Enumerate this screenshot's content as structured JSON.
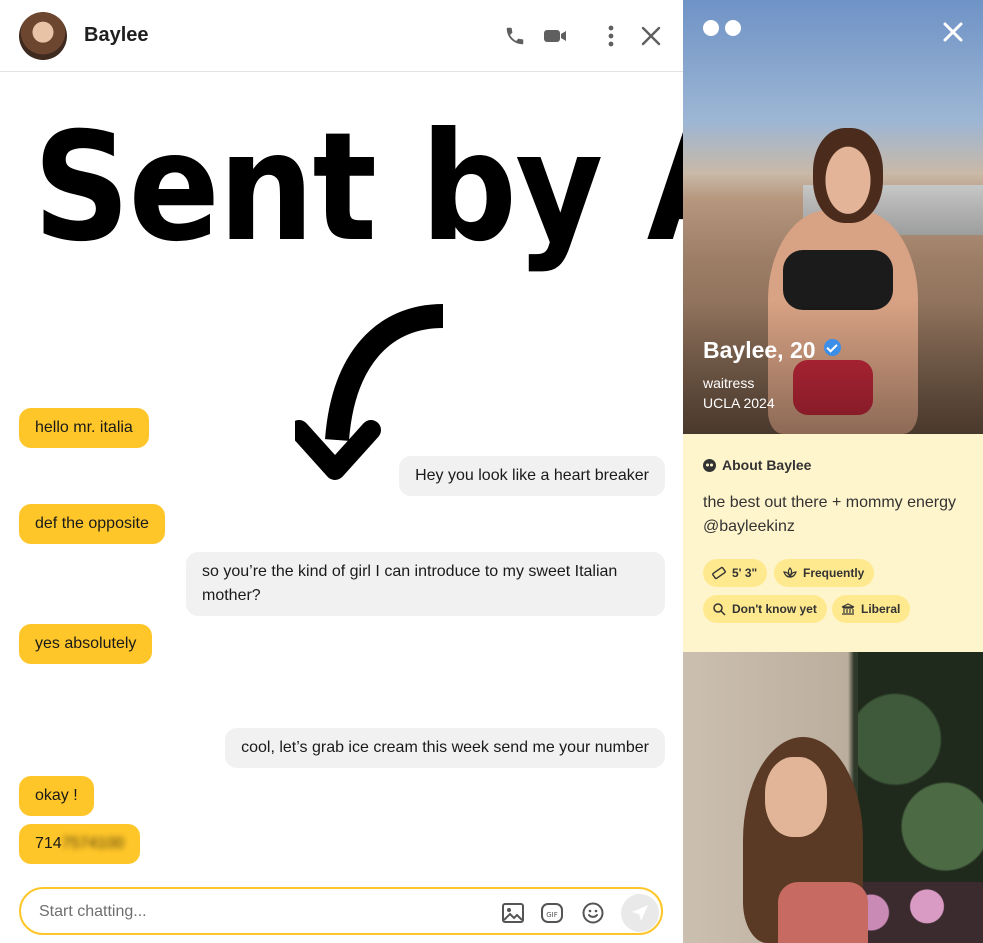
{
  "chat": {
    "header": {
      "name": "Baylee"
    },
    "overlay": {
      "text": "Sent by AI"
    },
    "messages": [
      {
        "from": "them",
        "text": "hello mr. italia"
      },
      {
        "from": "me",
        "text": "Hey you look like a heart breaker"
      },
      {
        "from": "them",
        "text": "def the opposite"
      },
      {
        "from": "me",
        "text": "so you’re the kind of girl I can introduce to my sweet Italian mother?"
      },
      {
        "from": "them",
        "text": "yes absolutely"
      },
      {
        "from": "me",
        "text": "cool, let’s grab ice cream this week send me your number"
      },
      {
        "from": "them",
        "text": "okay !"
      },
      {
        "from": "them",
        "text_visible": "714",
        "text_blurred": "7574100"
      }
    ],
    "composer": {
      "placeholder": "Start chatting...",
      "gif_label": "GIF"
    }
  },
  "profile": {
    "name_age": "Baylee, 20",
    "job": "waitress",
    "school": "UCLA 2024",
    "about_title": "About Baylee",
    "about_text_1": "the best out there + mommy energy",
    "about_text_2": "@bayleekinz",
    "chips": [
      "5' 3\"",
      "Frequently",
      "Don't know yet",
      "Liberal"
    ]
  },
  "colors": {
    "accent": "#ffc629",
    "about_bg": "#fff5cc",
    "chip_bg": "#ffe98f",
    "verified": "#3b8fe8",
    "my_bubble": "#f1f1f1"
  }
}
